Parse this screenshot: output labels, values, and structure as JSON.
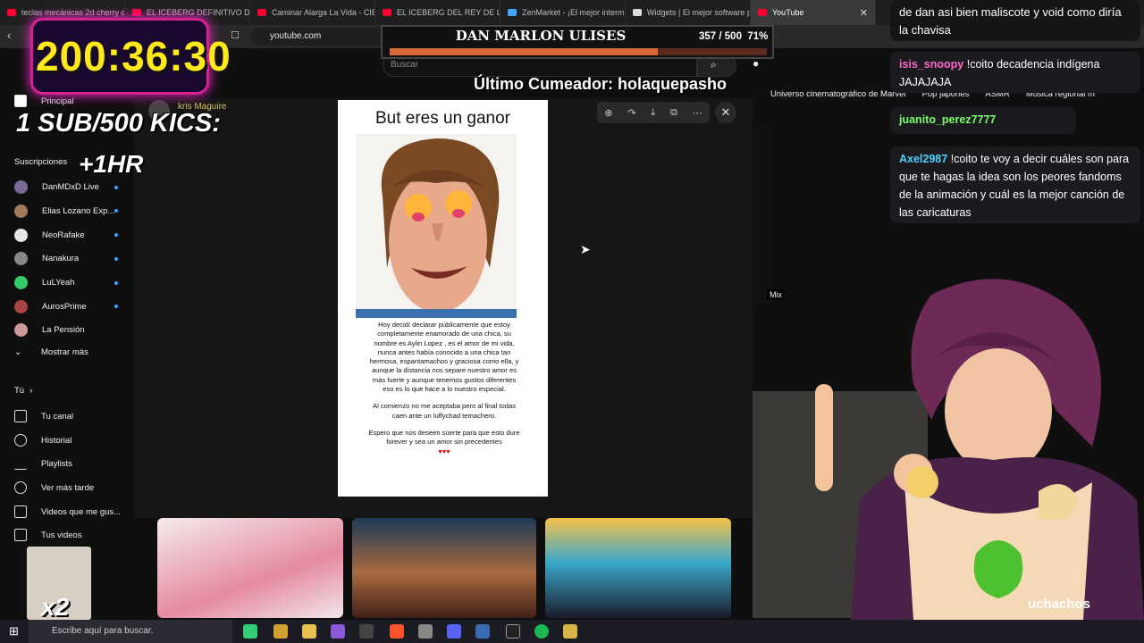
{
  "browser": {
    "tabs": [
      {
        "label": "teclas mecánicas 2d cherry o",
        "active": false
      },
      {
        "label": "EL ICEBERG DEFINITIVO DE M",
        "active": false
      },
      {
        "label": "Caminar Alarga La Vida - CIEN",
        "active": false
      },
      {
        "label": "EL ICEBERG DEL REY DE LAS B",
        "active": false
      },
      {
        "label": "ZenMarket - ¡El mejor interme",
        "active": false
      },
      {
        "label": "Widgets | El mejor software p",
        "active": false
      },
      {
        "label": "YouTube",
        "active": true
      }
    ],
    "url": "youtube.com"
  },
  "youtube": {
    "search_placeholder": "Buscar",
    "chips": [
      "Universo cinematográfico de Marvel",
      "Pop japonés",
      "ASMR",
      "Música regional m"
    ],
    "sidebar": {
      "principal": "Principal",
      "subs_header": "Suscripciones",
      "subscriptions": [
        "DanMDxD Live",
        "Elias Lozano Exp...",
        "NeoRafake",
        "Nanakura",
        "LuLYeah",
        "AurosPrime",
        "La Pensión"
      ],
      "show_more": "Mostrar más",
      "you_header": "Tú",
      "you_items": [
        "Tu canal",
        "Historial",
        "Playlists",
        "Ver más tarde",
        "Videos que me gus...",
        "Tus videos"
      ]
    },
    "channel_name": "kris Maguire",
    "mix_label": "Mix"
  },
  "viewer": {
    "title": "But eres un ganor",
    "paragraphs": [
      "Hoy decidí declarar públicamente que estoy completamente enamorado de una chica, su nombre es Aylin Lopez , es el amor de mi vida, nunca antes había conocido a una chica tan hermosa, espantamachos y graciosa como ella, y aunque la distancia nos separe nuestro amor es más fuerte y aunque tenemos gustos diferentes eso es lo que hace a lo nuestro especial.",
      "Al comienzo no me aceptaba pero al final todas caen ante un luffychad temachero.",
      "Espero que nos deseen suerte para que esto dure forever y sea un amor sin precedentes"
    ],
    "hearts": "♥♥♥"
  },
  "overlay": {
    "timer": "200:36:30",
    "sub_line": "1 SUB/500 KICS:",
    "hr_line": "+1HR",
    "goal_title": "DAN MARLON ULISES",
    "goal_count": "357 / 500",
    "goal_percent": "71%",
    "goal_fraction": 0.71,
    "cumeador": "Último Cumeador: holaquepasho",
    "x2": "x2",
    "muchachos": "uchachos"
  },
  "chat": [
    {
      "user": "",
      "text": "de dan asi bien maliscote y void como diría la chavisa",
      "color": "#ffffff"
    },
    {
      "user": "isis_snoopy",
      "text": "!coito decadencia indígena JAJAJAJA",
      "color": "#ff6ac8"
    },
    {
      "user": "juanito_perez7777",
      "text": "",
      "color": "#7cfc6a"
    },
    {
      "user": "Axel2987",
      "text": "!coito te voy a decir cuáles son para que te hagas la idea son los peores fandoms de la animación y cuál es la mejor canción de las caricaturas",
      "color": "#4fd1ff"
    }
  ],
  "taskbar": {
    "search_placeholder": "Escribe aquí para buscar."
  }
}
